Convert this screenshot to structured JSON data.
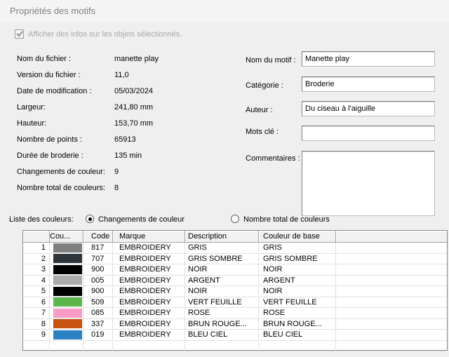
{
  "window": {
    "title": "Propriétés des motifs"
  },
  "colors": {
    "dialog_bg": "#efefef",
    "header_strip_bg": "#f4f4f4",
    "title_text": "#7f7f7f",
    "disabled_text": "#a9a9a9",
    "input_border": "#7b7b7b",
    "table_grid": "#e0e0e0",
    "table_header_border": "#a3a3a3"
  },
  "checkbox": {
    "label": "Afficher des infos sur les objets sélectionnés.",
    "checked": true,
    "disabled": true
  },
  "file_info": {
    "rows": [
      {
        "label": "Nom du fichier :",
        "value": "manette play"
      },
      {
        "label": "Version du fichier :",
        "value": "11,0"
      },
      {
        "label": "Date de modification :",
        "value": "05/03/2024"
      },
      {
        "label": "Largeur:",
        "value": "241,80 mm"
      },
      {
        "label": "Hauteur:",
        "value": "153,70 mm"
      },
      {
        "label": "Nombre de points :",
        "value": "65913"
      },
      {
        "label": "Durée de broderie :",
        "value": "135 min"
      },
      {
        "label": "Changements de couleur:",
        "value": "9"
      },
      {
        "label": "Nombre total de couleurs:",
        "value": "8"
      }
    ]
  },
  "form": {
    "fields": [
      {
        "label": "Nom du motif :",
        "value": "Manette play"
      },
      {
        "label": "Catégorie :",
        "value": "Broderie"
      },
      {
        "label": "Auteur :",
        "value": "Du ciseau à l'aiguille"
      },
      {
        "label": "Mots clé :",
        "value": ""
      },
      {
        "label": "Commentaires :",
        "value": ""
      }
    ]
  },
  "color_list": {
    "label": "Liste des couleurs:",
    "options": [
      {
        "label": "Changements de couleur",
        "selected": true
      },
      {
        "label": "Nombre total de couleurs",
        "selected": false
      }
    ]
  },
  "table": {
    "headers": {
      "num": "",
      "color": "Cou...",
      "code": "Code",
      "brand": "Marque",
      "description": "Description",
      "base": "Couleur de base"
    },
    "rows": [
      {
        "num": "1",
        "swatch": "#808080",
        "code": "817",
        "brand": "EMBROIDERY",
        "description": "GRIS",
        "base": "GRIS"
      },
      {
        "num": "2",
        "swatch": "#2d353b",
        "code": "707",
        "brand": "EMBROIDERY",
        "description": "GRIS SOMBRE",
        "base": "GRIS SOMBRE"
      },
      {
        "num": "3",
        "swatch": "#000000",
        "code": "900",
        "brand": "EMBROIDERY",
        "description": "NOIR",
        "base": "NOIR"
      },
      {
        "num": "4",
        "swatch": "#ababab",
        "code": "005",
        "brand": "EMBROIDERY",
        "description": "ARGENT",
        "base": "ARGENT"
      },
      {
        "num": "5",
        "swatch": "#000000",
        "code": "900",
        "brand": "EMBROIDERY",
        "description": "NOIR",
        "base": "NOIR"
      },
      {
        "num": "6",
        "swatch": "#5cb64b",
        "code": "509",
        "brand": "EMBROIDERY",
        "description": "VERT FEUILLE",
        "base": "VERT FEUILLE"
      },
      {
        "num": "7",
        "swatch": "#f79dc5",
        "code": "085",
        "brand": "EMBROIDERY",
        "description": "ROSE",
        "base": "ROSE"
      },
      {
        "num": "8",
        "swatch": "#c85310",
        "code": "337",
        "brand": "EMBROIDERY",
        "description": "BRUN ROUGE...",
        "base": "BRUN ROUGE..."
      },
      {
        "num": "9",
        "swatch": "#2b82c3",
        "code": "019",
        "brand": "EMBROIDERY",
        "description": "BLEU CIEL",
        "base": "BLEU CIEL"
      }
    ]
  }
}
